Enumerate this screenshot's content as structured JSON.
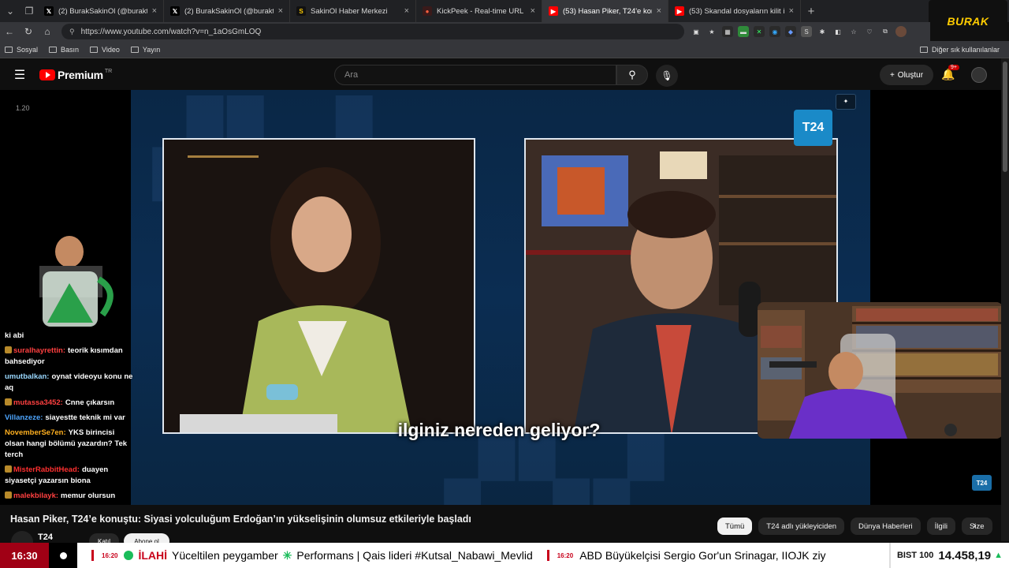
{
  "browser": {
    "tabs": [
      {
        "title": "(2) BurakSakinOl (@buraktut_) / X",
        "favicon": "x-icon",
        "active": false
      },
      {
        "title": "(2) BurakSakinOl (@buraktut_) / X",
        "favicon": "x-icon",
        "active": false
      },
      {
        "title": "SakinOl Haber Merkezi",
        "favicon": "sakinol-icon",
        "active": false
      },
      {
        "title": "KickPeek - Real-time URL Crawler",
        "favicon": "kickpeek-icon",
        "active": false
      },
      {
        "title": "(53) Hasan Piker, T24'e konuş",
        "favicon": "youtube-icon",
        "active": true
      },
      {
        "title": "(53) Skandal dosyaların kilit ismi: A",
        "favicon": "youtube-icon",
        "active": false
      }
    ],
    "url": "https://www.youtube.com/watch?v=n_1aOsGmLOQ",
    "bookmarks": [
      "Sosyal",
      "Basın",
      "Video",
      "Yayın"
    ],
    "other_bookmarks": "Diğer sık kullanılanlar"
  },
  "overlay_brand": "BURAK",
  "youtube": {
    "brand": "Premium",
    "region": "TR",
    "search_placeholder": "Ara",
    "create_label": "Oluştur",
    "notifications": "9+"
  },
  "stream": {
    "corner_counter": "1.20",
    "network_logo": "T24",
    "plus_badge": "✦",
    "subtitle": "ilginiz nereden geliyor?",
    "chat": [
      {
        "user": "",
        "text": "ki abi",
        "user_color": "#ffffff",
        "badge": false
      },
      {
        "user": "suralhayrettin:",
        "text": "teorik kısımdan bahsediyor",
        "user_color": "#ff4040",
        "badge": true
      },
      {
        "user": "umutbalkan:",
        "text": "oynat videoyu konu ne aq",
        "user_color": "#9ad8ff",
        "badge": false
      },
      {
        "user": "mutassa3452:",
        "text": "Cnne çıkarsın",
        "user_color": "#ff4040",
        "badge": true
      },
      {
        "user": "Villanzeze:",
        "text": "siayestte teknik mi var",
        "user_color": "#4ea6ff",
        "badge": false
      },
      {
        "user": "NovemberSe7en:",
        "text": "YKS birincisi olsan hangi bölümü yazardın? Tek terch",
        "user_color": "#ffb020",
        "badge": false
      },
      {
        "user": "MisterRabbitHead:",
        "text": "duayen siyasetçi yazarsın biona",
        "user_color": "#ff3030",
        "badge": true
      },
      {
        "user": "malekbilayk:",
        "text": "memur olursun",
        "user_color": "#ff4040",
        "badge": true
      }
    ]
  },
  "video": {
    "title": "Hasan Piker, T24’e konuştu: Siyasi yolculuğum Erdoğan’ın yükselişinin olumsuz etkileriyle başladı",
    "channel": "T24",
    "join_label": "Katıl",
    "subscribe_label": "Abone ol",
    "chips": [
      "Tümü",
      "T24 adlı yükleyiciden",
      "Dünya Haberleri",
      "İlgili",
      "Size"
    ]
  },
  "ticker": {
    "time": "16:30",
    "stamp1": "16:20",
    "item1_red": "İLAHİ",
    "item1_text": "Yüceltilen peygamber",
    "item2_text": "Performans | Qais lideri #Kutsal_Nabawi_Mevlid",
    "stamp2": "16:20",
    "item3_text": "ABD Büyükelçisi Sergio Gor'un Srinagar, IIOJK ziy",
    "bist_label": "BIST 100",
    "bist_value": "14.458,19",
    "bist_trend": "▲"
  }
}
